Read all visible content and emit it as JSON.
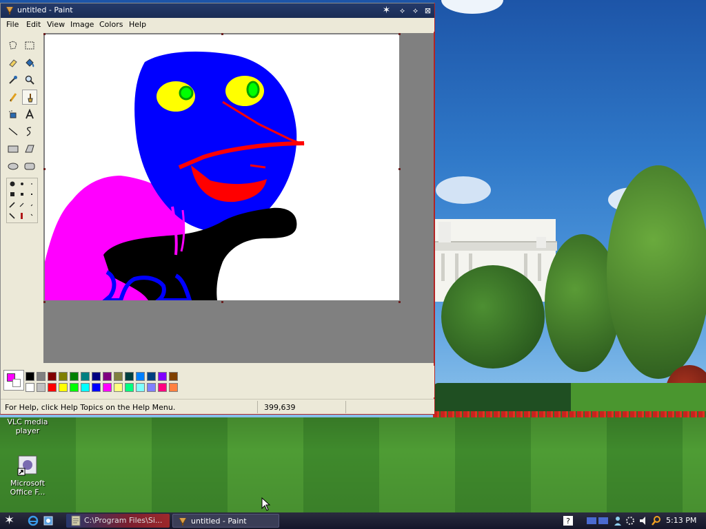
{
  "window": {
    "title": "untitled - Paint",
    "menu": [
      "File",
      "Edit",
      "View",
      "Image",
      "Colors",
      "Help"
    ]
  },
  "toolbox": {
    "tools": [
      "free-form-select",
      "select",
      "eraser",
      "fill-with-color",
      "pick-color",
      "magnifier",
      "pencil",
      "brush",
      "airbrush",
      "text",
      "line",
      "curve",
      "rectangle",
      "polygon",
      "ellipse",
      "rounded-rectangle"
    ],
    "selected_tool": "brush"
  },
  "palette": {
    "foreground": "#ff00ff",
    "background": "#ffffff",
    "colors_row1": [
      "#000000",
      "#808080",
      "#800000",
      "#808000",
      "#008000",
      "#008080",
      "#000080",
      "#800080",
      "#808040",
      "#004040",
      "#0080ff",
      "#004080",
      "#8000ff",
      "#804000"
    ],
    "colors_row2": [
      "#ffffff",
      "#c0c0c0",
      "#ff0000",
      "#ffff00",
      "#00ff00",
      "#00ffff",
      "#0000ff",
      "#ff00ff",
      "#ffff80",
      "#00ff80",
      "#80ffff",
      "#8080ff",
      "#ff0080",
      "#ff8040"
    ]
  },
  "status": {
    "help_text": "For Help, click Help Topics on the Help Menu.",
    "coordinates": "399,639"
  },
  "desktop_icons": [
    {
      "label_line1": "VLC media",
      "label_line2": "player"
    },
    {
      "label_line1": "Microsoft",
      "label_line2": "Office F..."
    }
  ],
  "taskbar": {
    "tasks": [
      {
        "label": "C:\\Program Files\\Si..."
      },
      {
        "label": "untitled - Paint"
      }
    ],
    "clock": "5:13 PM"
  }
}
